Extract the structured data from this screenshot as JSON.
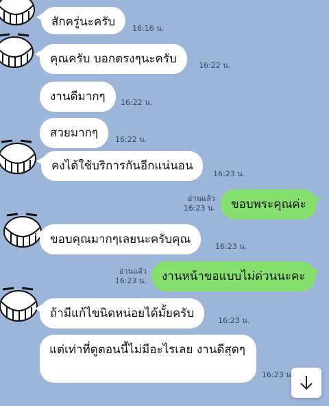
{
  "messages": [
    {
      "text": "สักครู่นะครับ",
      "time": "16:16 น."
    },
    {
      "text": "คุณครับ บอกตรงๆนะครับ",
      "time": "16:22 น."
    },
    {
      "text": "งานดีมากๆ",
      "time": "16:22 น."
    },
    {
      "text": "สวยมากๆ",
      "time": "16:22 น."
    },
    {
      "text": "คงได้ใช้บริการกันอีกแน่นอน",
      "time": "16:23 น."
    },
    {
      "text": "ขอบพระคุณค่ะ",
      "time": "16:23 น.",
      "read": "อ่านแล้ว"
    },
    {
      "text": "ขอบคุณมากๆเลยนะครับคุณ",
      "time": "16:23 น."
    },
    {
      "text": "งานหน้าขอแบบไม่ด่วนนะคะ",
      "time": "16:23 น.",
      "read": "อ่านแล้ว"
    },
    {
      "text": "ถ้ามีแก้ไขนิดหน่อยได้มั้ยครับ",
      "time": "16:23 น."
    },
    {
      "text": "แต่เท่าที่ดูตอนนี้ไม่มีอะไรเลย งานดีสุดๆ",
      "time": "16:23 น."
    }
  ],
  "colors": {
    "background": "#9db5d9",
    "incoming": "#ffffff",
    "outgoing": "#86df6f"
  },
  "icons": {
    "scroll_down": "arrow-down-icon",
    "avatar": "grin-face-avatar"
  }
}
